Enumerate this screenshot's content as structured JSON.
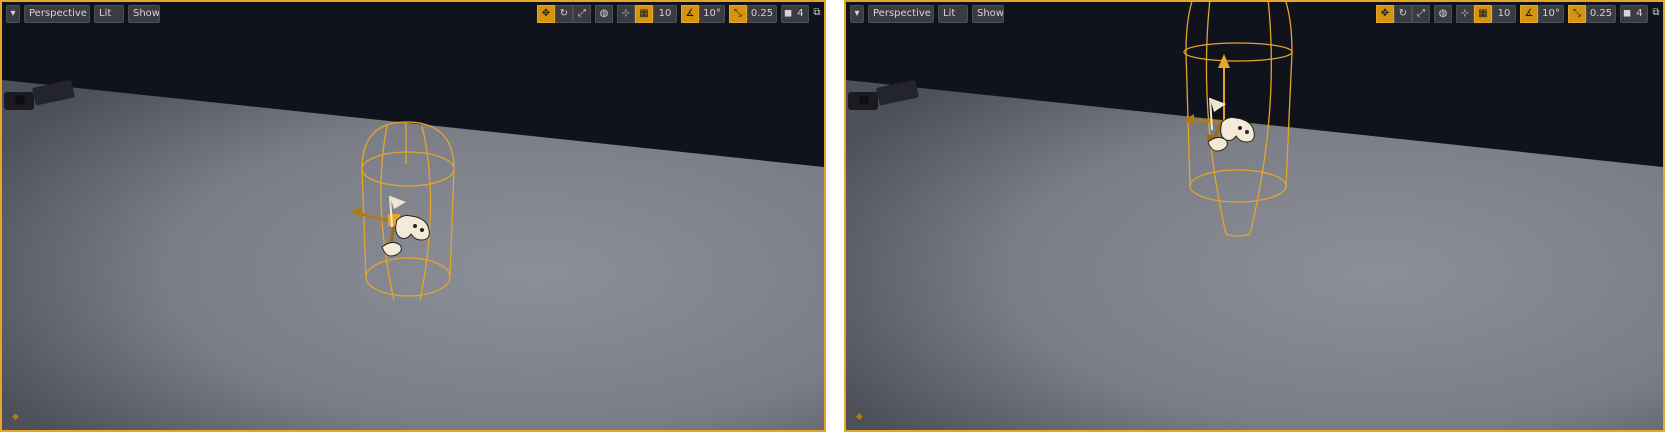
{
  "viewports": [
    {
      "id": "left",
      "toolbar": {
        "menu_icon": "chevron-down-icon",
        "view_mode_label": "Perspective",
        "lighting_label": "Lit",
        "show_label": "Show",
        "transform_icons": [
          "move-icon",
          "rotate-icon",
          "scale-icon"
        ],
        "coord_space_icon": "globe-icon",
        "surface_snap_icon": "surface-snap-icon",
        "grid_snap_icon": "grid-icon",
        "grid_snap_value": "10",
        "rotation_snap_icon": "angle-icon",
        "rotation_snap_value": "10°",
        "scale_snap_icon": "scale-snap-icon",
        "scale_snap_value": "0.25",
        "camera_speed_icon": "camera-icon",
        "camera_speed_value": "4",
        "maximize_icon": "maximize-icon"
      },
      "selection_capsule": "orange wireframe capsule around player start with transform gizmo"
    },
    {
      "id": "right",
      "toolbar": {
        "menu_icon": "chevron-down-icon",
        "view_mode_label": "Perspective",
        "lighting_label": "Lit",
        "show_label": "Show",
        "transform_icons": [
          "move-icon",
          "rotate-icon",
          "scale-icon"
        ],
        "coord_space_icon": "globe-icon",
        "surface_snap_icon": "surface-snap-icon",
        "grid_snap_icon": "grid-icon",
        "grid_snap_value": "10",
        "rotation_snap_icon": "angle-icon",
        "rotation_snap_value": "10°",
        "scale_snap_icon": "scale-snap-icon",
        "scale_snap_value": "0.25",
        "camera_speed_icon": "camera-icon",
        "camera_speed_value": "4",
        "maximize_icon": "maximize-icon"
      }
    }
  ],
  "colors": {
    "selection": "#e3a52a",
    "sky": "#10121c",
    "floor_light": "#8d9099",
    "floor_dark": "#4d5058",
    "toolbar_bg": "#3a3c42",
    "toolbar_active": "#d4940f"
  }
}
